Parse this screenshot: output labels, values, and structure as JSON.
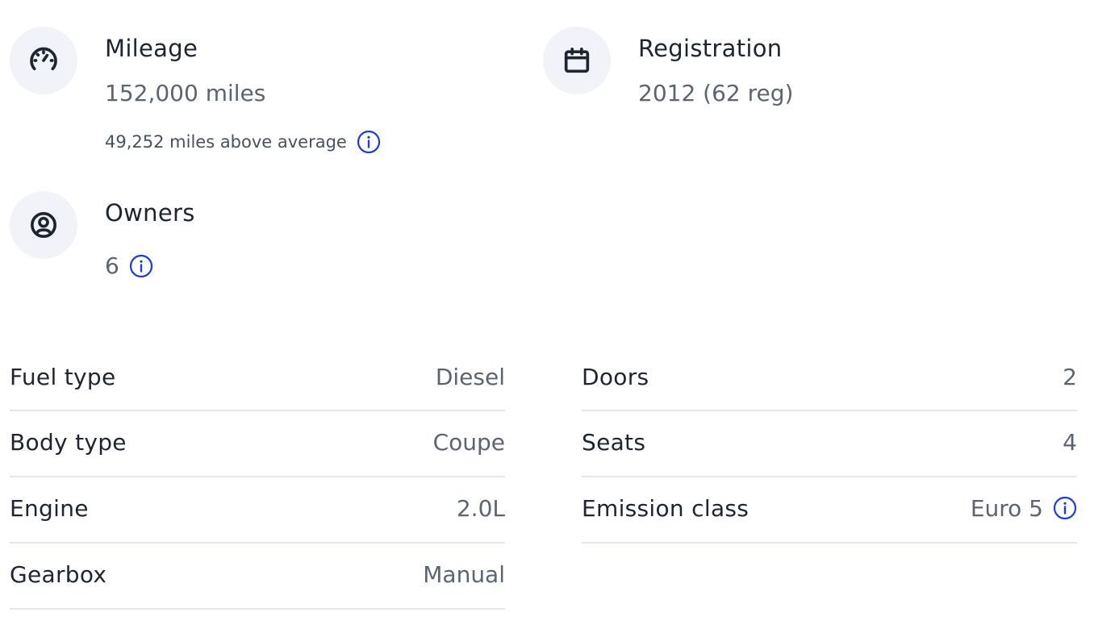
{
  "key_specs": {
    "mileage": {
      "icon": "speedometer-icon",
      "label": "Mileage",
      "value": "152,000 miles",
      "note": "49,252 miles above average"
    },
    "registration": {
      "icon": "calendar-icon",
      "label": "Registration",
      "value": "2012 (62 reg)"
    },
    "owners": {
      "icon": "user-circle-icon",
      "label": "Owners",
      "value": "6"
    }
  },
  "details_left": [
    {
      "label": "Fuel type",
      "value": "Diesel"
    },
    {
      "label": "Body type",
      "value": "Coupe"
    },
    {
      "label": "Engine",
      "value": "2.0L"
    },
    {
      "label": "Gearbox",
      "value": "Manual"
    }
  ],
  "details_right": [
    {
      "label": "Doors",
      "value": "2"
    },
    {
      "label": "Seats",
      "value": "4"
    },
    {
      "label": "Emission class",
      "value": "Euro 5",
      "has_info": true
    }
  ],
  "colors": {
    "info_accent": "#1f3bd8",
    "icon_background": "#f1f3f8",
    "divider": "#e3e5ea"
  }
}
